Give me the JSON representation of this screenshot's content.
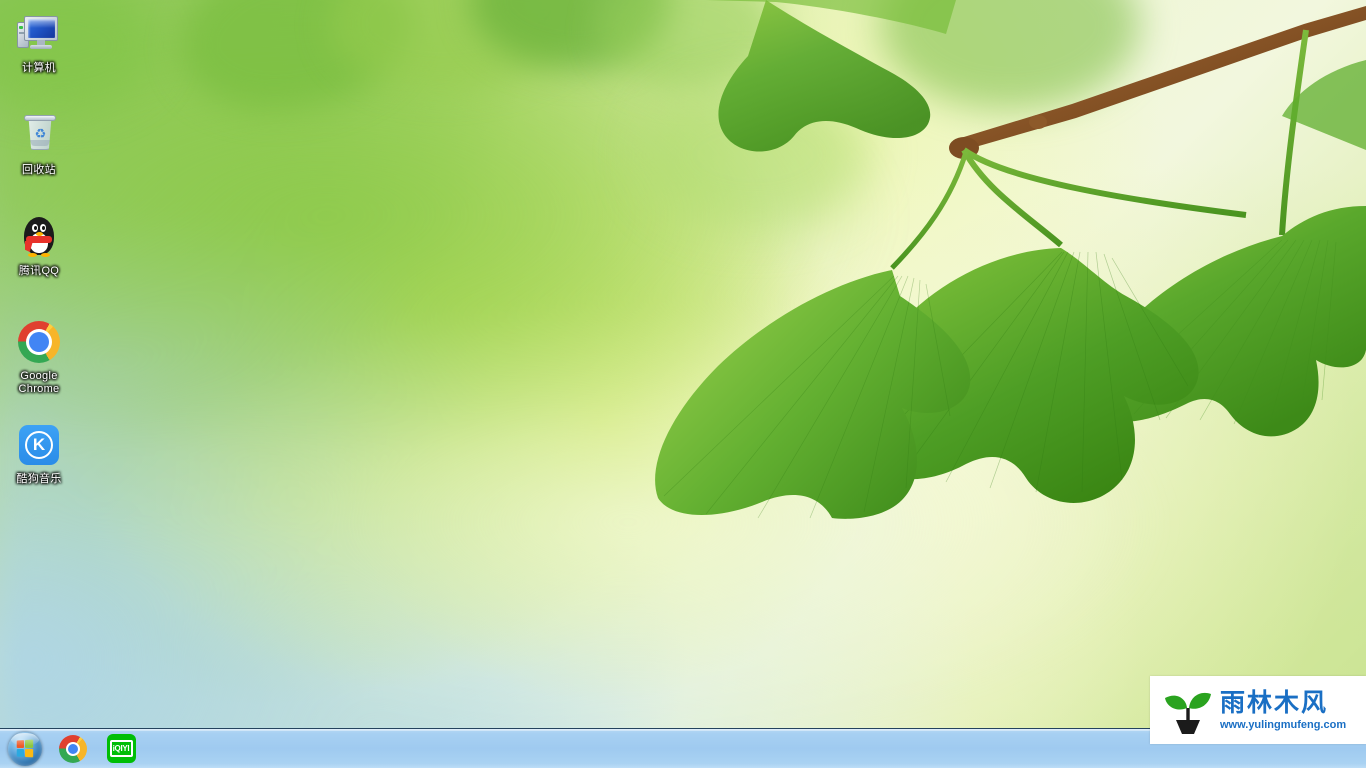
{
  "desktop": {
    "wallpaper_description": "Blurred bokeh green ginkgo leaves on branch",
    "icons": [
      {
        "name": "computer",
        "label": "计算机",
        "icon": "computer-icon"
      },
      {
        "name": "recycle-bin",
        "label": "回收站",
        "icon": "recycle-bin-icon"
      },
      {
        "name": "tencent-qq",
        "label": "腾讯QQ",
        "icon": "qq-penguin-icon"
      },
      {
        "name": "google-chrome",
        "label": "Google Chrome",
        "icon": "chrome-icon"
      },
      {
        "name": "kugou-music",
        "label": "酷狗音乐",
        "icon": "kugou-icon"
      }
    ]
  },
  "taskbar": {
    "start_button": {
      "label": "开始",
      "icon": "windows-start-orb-icon"
    },
    "pinned": [
      {
        "name": "chrome",
        "label": "Google Chrome",
        "icon": "chrome-icon"
      },
      {
        "name": "iqiyi",
        "label": "iQIYI",
        "icon": "iqiyi-icon",
        "logo_text": "iQIYI"
      }
    ],
    "tray": []
  },
  "watermark": {
    "brand": "雨林木风",
    "url": "www.yulingmufeng.com",
    "logo": "sprout-seedling-icon",
    "brand_color": "#1a6fc4",
    "leaf_color": "#2aa31f"
  },
  "colors": {
    "taskbar_top": "#b6d9f5",
    "taskbar_bottom": "#bcddf7",
    "taskbar_border": "#24435e",
    "label_text": "#ffffff",
    "leaf_green": "#5fae2e",
    "leaf_green_dark": "#3f8d1c",
    "branch_brown": "#8a5a2b"
  }
}
